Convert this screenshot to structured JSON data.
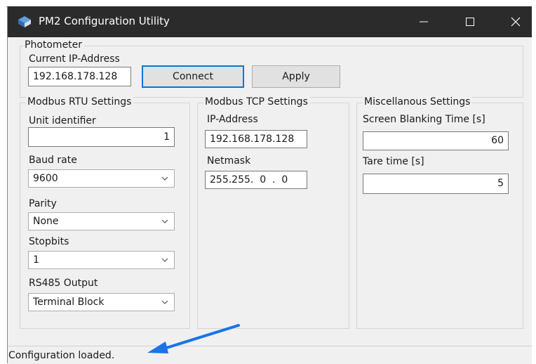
{
  "window": {
    "title": "PM2 Configuration Utility"
  },
  "photometer": {
    "legend": "Photometer",
    "ip_label": "Current IP-Address",
    "ip_value": "192.168.178.128",
    "connect_label": "Connect",
    "apply_label": "Apply"
  },
  "rtu": {
    "legend": "Modbus RTU Settings",
    "unit_label": "Unit identifier",
    "unit_value": "1",
    "baud_label": "Baud rate",
    "baud_value": "9600",
    "parity_label": "Parity",
    "parity_value": "None",
    "stopbits_label": "Stopbits",
    "stopbits_value": "1",
    "rs485_label": "RS485 Output",
    "rs485_value": "Terminal Block"
  },
  "tcp": {
    "legend": "Modbus TCP Settings",
    "ip_label": "IP-Address",
    "ip_value": "192.168.178.128",
    "netmask_label": "Netmask",
    "netmask_value": "255.255.  0  .  0"
  },
  "misc": {
    "legend": "Miscellanous Settings",
    "blank_label": "Screen Blanking Time [s]",
    "blank_value": "60",
    "tare_label": "Tare time [s]",
    "tare_value": "5"
  },
  "status": {
    "text": "Configuration loaded."
  },
  "colors": {
    "titlebar": "#2b2b2b",
    "window_bg": "#f0f0f0",
    "focus_border": "#0078d7",
    "annotation_arrow": "#1a73e8"
  }
}
